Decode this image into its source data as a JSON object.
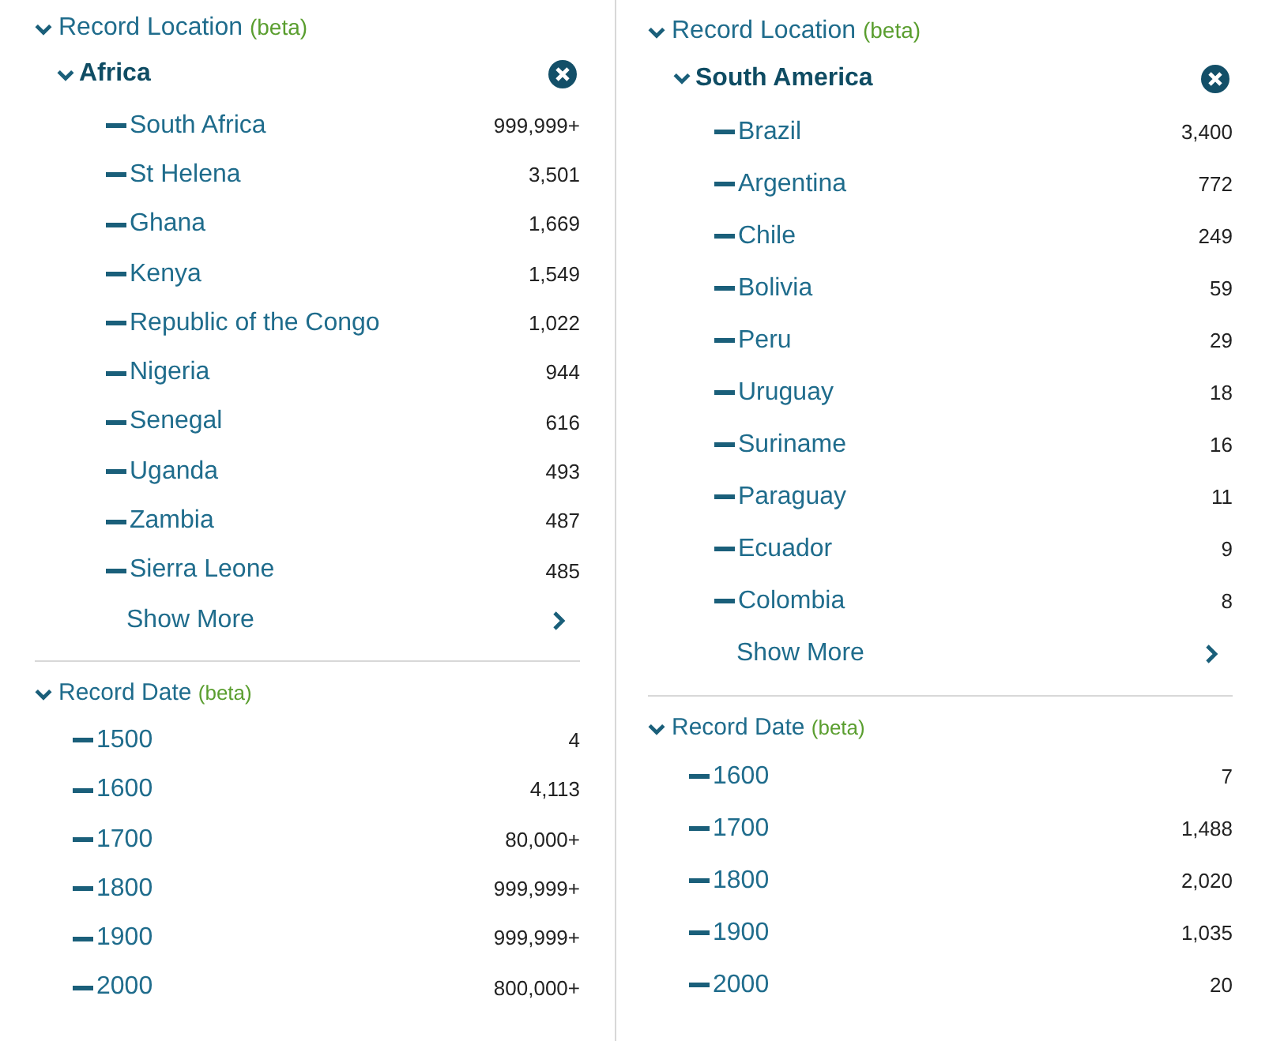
{
  "panels": [
    {
      "location": {
        "title": "Record Location",
        "tag": "(beta)",
        "expanded": true,
        "region": {
          "label": "Africa",
          "expanded": true,
          "items": [
            {
              "label": "South Africa",
              "count": "999,999+"
            },
            {
              "label": "St Helena",
              "count": "3,501"
            },
            {
              "label": "Ghana",
              "count": "1,669"
            },
            {
              "label": "Kenya",
              "count": "1,549"
            },
            {
              "label": "Republic of the Congo",
              "count": "1,022"
            },
            {
              "label": "Nigeria",
              "count": "944"
            },
            {
              "label": "Senegal",
              "count": "616"
            },
            {
              "label": "Uganda",
              "count": "493"
            },
            {
              "label": "Zambia",
              "count": "487"
            },
            {
              "label": "Sierra Leone",
              "count": "485"
            }
          ],
          "show_more": "Show More"
        }
      },
      "date": {
        "title": "Record Date",
        "tag": "(beta)",
        "expanded": true,
        "items": [
          {
            "label": "1500",
            "count": "4"
          },
          {
            "label": "1600",
            "count": "4,113"
          },
          {
            "label": "1700",
            "count": "80,000+"
          },
          {
            "label": "1800",
            "count": "999,999+"
          },
          {
            "label": "1900",
            "count": "999,999+"
          },
          {
            "label": "2000",
            "count": "800,000+"
          }
        ]
      }
    },
    {
      "location": {
        "title": "Record Location",
        "tag": "(beta)",
        "expanded": true,
        "region": {
          "label": "South America",
          "expanded": true,
          "items": [
            {
              "label": "Brazil",
              "count": "3,400"
            },
            {
              "label": "Argentina",
              "count": "772"
            },
            {
              "label": "Chile",
              "count": "249"
            },
            {
              "label": "Bolivia",
              "count": "59"
            },
            {
              "label": "Peru",
              "count": "29"
            },
            {
              "label": "Uruguay",
              "count": "18"
            },
            {
              "label": "Suriname",
              "count": "16"
            },
            {
              "label": "Paraguay",
              "count": "11"
            },
            {
              "label": "Ecuador",
              "count": "9"
            },
            {
              "label": "Colombia",
              "count": "8"
            }
          ],
          "show_more": "Show More"
        }
      },
      "date": {
        "title": "Record Date",
        "tag": "(beta)",
        "expanded": true,
        "items": [
          {
            "label": "1600",
            "count": "7"
          },
          {
            "label": "1700",
            "count": "1,488"
          },
          {
            "label": "1800",
            "count": "2,020"
          },
          {
            "label": "1900",
            "count": "1,035"
          },
          {
            "label": "2000",
            "count": "20"
          }
        ]
      }
    }
  ]
}
